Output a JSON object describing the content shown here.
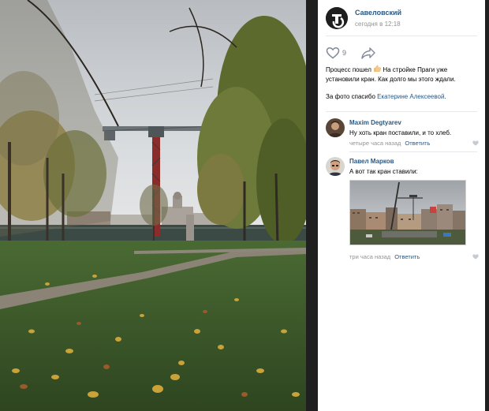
{
  "post": {
    "author": "Савеловский",
    "time": "сегодня в 12:18",
    "likes": "9",
    "text_line1_a": "Процесс пошел",
    "text_line1_b": "На стройке Праги уже",
    "text_line2": "установили кран. Как долго мы этого ждали.",
    "thanks_prefix": "За фото спасибо ",
    "thanks_link": "Екатерине Алексеевой",
    "thanks_suffix": "."
  },
  "comments": [
    {
      "author": "Maxim Degtyarev",
      "text": "Ну хоть кран поставили, и то хлеб.",
      "time": "четыре часа назад",
      "reply": "Ответить"
    },
    {
      "author": "Павел Марков",
      "text": "А вот так кран ставили:",
      "time": "три часа назад",
      "reply": "Ответить"
    }
  ],
  "icons": {
    "like": "heart-icon",
    "share": "share-arrow-icon",
    "comment_like": "heart-icon",
    "thumbs_up": "thumbs-up-emoji"
  },
  "colors": {
    "link": "#2a5885",
    "muted": "#939393",
    "grass": "#3f5a2a"
  }
}
